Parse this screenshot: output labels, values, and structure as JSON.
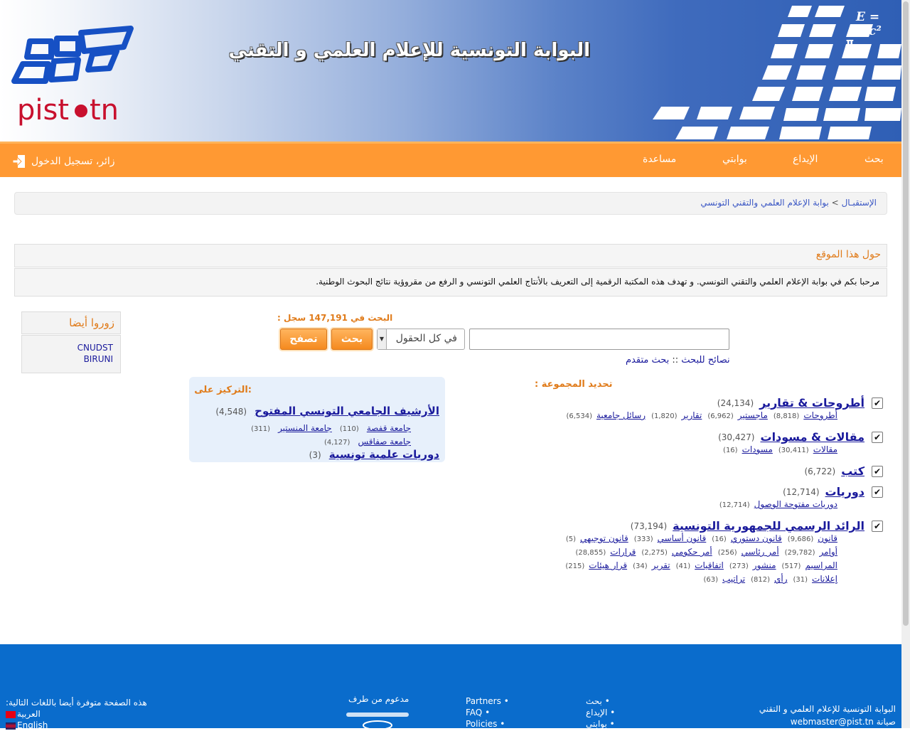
{
  "header": {
    "logo_text": "pist.tn",
    "site_title": "البوابة التونسية للإعلام العلمي و التقني",
    "formula": "E = mc²"
  },
  "nav": {
    "items": [
      "بحث",
      "الإيداع",
      "بوابتي",
      "مساعدة"
    ],
    "login": "زائر، تسجيل الدخول"
  },
  "breadcrumb": {
    "home": "الإستقبـال",
    "separator": ">",
    "current": "بوابة الإعلام العلمي والتقني التونسي"
  },
  "about": {
    "title": "حول هذا الموقع",
    "text": "مرحبا بكم في بوابة الإعلام العلمي والتقني التونسي. و تهدف هذه المكتبة الرقمية إلى التعريف بالأنتاج العلمي التونسي و الرفع من مقروؤية نتائج البحوث الوطنية."
  },
  "visit": {
    "title": "زوروا أيضا",
    "links": [
      "CNUDST",
      "BIRUNI"
    ]
  },
  "search": {
    "count_label": "البحث في 147,191 سجل :",
    "field_value": "في كل الحقول",
    "search_button": "بحث",
    "browse_button": "تصفح",
    "tips": "نصائح للبحث",
    "sep": "::",
    "advanced": "بحث متقدم"
  },
  "collections": {
    "title": "تحديد المجموعة :",
    "groups": [
      {
        "name": "أطروحات & تقارير",
        "count": "(24,134)",
        "checked": true,
        "sub_lines": [
          [
            [
              "أطروحات",
              "(8,818)"
            ],
            [
              "ماجستير",
              "(6,962)"
            ],
            [
              "تقارير",
              "(1,820)"
            ],
            [
              "رسائل جامعية",
              "(6,534)"
            ]
          ]
        ]
      },
      {
        "name": "مقالات & مسودات",
        "count": "(30,427)",
        "checked": true,
        "sub_lines": [
          [
            [
              "مقالات",
              "(30,411)"
            ],
            [
              "مسودات",
              "(16)"
            ]
          ]
        ]
      },
      {
        "name": "كتب",
        "count": "(6,722)",
        "checked": true,
        "sub_lines": []
      },
      {
        "name": "دوريات",
        "count": "(12,714)",
        "checked": true,
        "sub_lines": [
          [
            [
              "دوريات مفتوحة الوصول",
              "(12,714)"
            ]
          ]
        ]
      },
      {
        "name": "الرائد الرسمي للجمهورية التونسية",
        "count": "(73,194)",
        "checked": true,
        "sub_lines": [
          [
            [
              "قانون",
              "(9,686)"
            ],
            [
              "قانون دستوري",
              "(16)"
            ],
            [
              "قانون أساسي",
              "(333)"
            ],
            [
              "قانون توجيهي",
              "(5)"
            ]
          ],
          [
            [
              "أوامر",
              "(29,782)"
            ],
            [
              "أمر رئاسي",
              "(256)"
            ],
            [
              "أمر حكومي",
              "(2,275)"
            ],
            [
              "قرارات",
              "(28,855)"
            ]
          ],
          [
            [
              "المراسيم",
              "(517)"
            ],
            [
              "منشور",
              "(273)"
            ],
            [
              "اتفاقيات",
              "(41)"
            ],
            [
              "تقرير",
              "(34)"
            ],
            [
              "قرار هيئات",
              "(215)"
            ]
          ],
          [
            [
              "إعلانات",
              "(31)"
            ],
            [
              "رأي",
              "(812)"
            ],
            [
              "تراتيب",
              "(63)"
            ]
          ]
        ]
      }
    ]
  },
  "focus": {
    "title": ":التركيز على",
    "archive": {
      "name": "الأرشيف الجامعي التونسي المفتوح",
      "count": "(4,548)"
    },
    "archive_subs": [
      [
        [
          "جامعة قفصة",
          "(110)"
        ],
        [
          "جامعة المنستير",
          "(311)"
        ]
      ],
      [
        [
          "جامعة صفاقس",
          "(4,127)"
        ]
      ]
    ],
    "journals": {
      "name": "دوريات علمية تونسية",
      "count": "(3)"
    }
  },
  "footer": {
    "site_name": "البوابة التونسية للإعلام العلمي و التقني",
    "maintenance_label": "صيانة",
    "maintenance_email": "webmaster@pist.tn",
    "links1": [
      "بحث",
      "الإيداع",
      "بوابتي"
    ],
    "links2": [
      "Partners",
      "FAQ",
      "Policies"
    ],
    "supported_by": "مدعوم من طرف",
    "languages_label": "هذه الصفحة متوفرة أيضا باللغات التالية:",
    "languages": [
      "العربية",
      "English"
    ]
  },
  "colors": {
    "accent": "#ff9933",
    "header_blue": "#3f6bbd",
    "footer_blue": "#0a6ccc",
    "link": "#1a1a9c",
    "heading_orange": "#e07b1a"
  }
}
